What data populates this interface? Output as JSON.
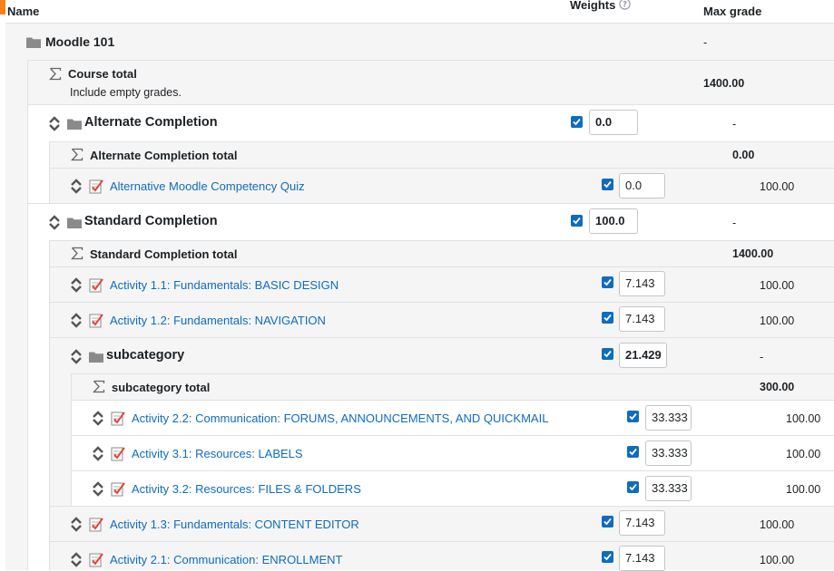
{
  "header": {
    "name": "Name",
    "weights": "Weights",
    "max_grade": "Max grade"
  },
  "rows": {
    "moodle101": {
      "label": "Moodle 101",
      "max": "-"
    },
    "course_total": {
      "label": "Course total",
      "sub": "Include empty grades.",
      "max": "1400.00"
    },
    "alt_cat": {
      "label": "Alternate Completion",
      "weight": "0.0",
      "max": "-"
    },
    "alt_total": {
      "label": "Alternate Completion total",
      "max": "0.00"
    },
    "alt_quiz": {
      "label": "Alternative Moodle Competency Quiz",
      "weight": "0.0",
      "max": "100.00"
    },
    "std_cat": {
      "label": "Standard Completion",
      "weight": "100.0",
      "max": "-"
    },
    "std_total": {
      "label": "Standard Completion total",
      "max": "1400.00"
    },
    "a11": {
      "label": "Activity 1.1: Fundamentals: BASIC DESIGN",
      "weight": "7.143",
      "max": "100.00"
    },
    "a12": {
      "label": "Activity 1.2: Fundamentals: NAVIGATION",
      "weight": "7.143",
      "max": "100.00"
    },
    "subcat": {
      "label": "subcategory",
      "weight": "21.429",
      "max": "-"
    },
    "subcat_total": {
      "label": "subcategory total",
      "max": "300.00"
    },
    "a22": {
      "label": "Activity 2.2: Communication: FORUMS, ANNOUNCEMENTS, AND QUICKMAIL",
      "weight": "33.333",
      "max": "100.00"
    },
    "a31": {
      "label": "Activity 3.1: Resources: LABELS",
      "weight": "33.333",
      "max": "100.00"
    },
    "a32": {
      "label": "Activity 3.2: Resources: FILES & FOLDERS",
      "weight": "33.333",
      "max": "100.00"
    },
    "a13": {
      "label": "Activity 1.3: Fundamentals: CONTENT EDITOR",
      "weight": "7.143",
      "max": "100.00"
    },
    "a21": {
      "label": "Activity 2.1: Communication: ENROLLMENT",
      "weight": "7.143",
      "max": "100.00"
    }
  },
  "icons": {
    "folder": "folder-icon",
    "sigma": "sigma-icon",
    "move": "move-icon",
    "assignment": "assignment-icon",
    "help": "help-icon"
  },
  "colors": {
    "link": "#0f6cbf",
    "checkbox": "#0f6cbf",
    "band": "#f5f5f5",
    "accent": "#f98012"
  }
}
